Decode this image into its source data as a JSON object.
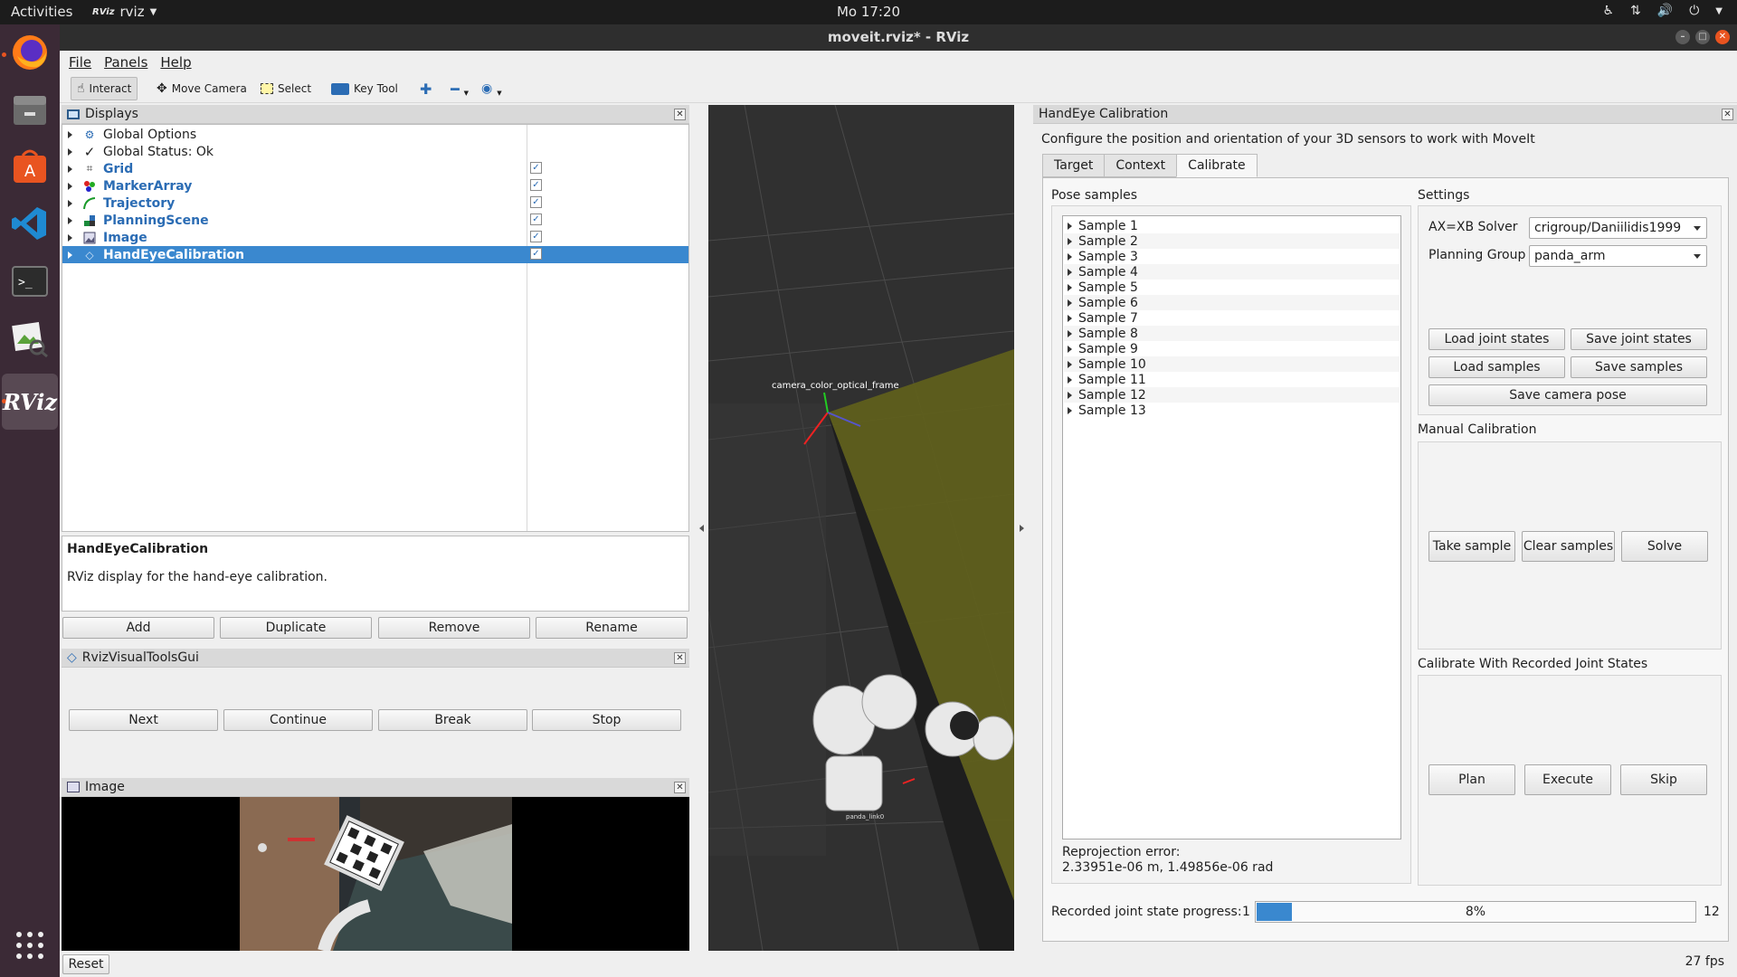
{
  "topbar": {
    "activities": "Activities",
    "app_icon": "RViz",
    "app_name": "rviz",
    "clock": "Mo 17:20"
  },
  "dock": {
    "apps": [
      "firefox-icon",
      "files-icon",
      "software-center-icon",
      "vscode-icon",
      "terminal-icon",
      "image-viewer-icon",
      "rviz-icon"
    ],
    "rviz_label": "RViz"
  },
  "window": {
    "title": "moveit.rviz* - RViz"
  },
  "menubar": {
    "items": [
      "File",
      "Panels",
      "Help"
    ]
  },
  "toolbar": {
    "interact": "Interact",
    "move_camera": "Move Camera",
    "select": "Select",
    "key_tool": "Key Tool"
  },
  "displays": {
    "title": "Displays",
    "items": [
      {
        "label": "Global Options"
      },
      {
        "label": "Global Status: Ok"
      },
      {
        "label": "Grid",
        "checked": true
      },
      {
        "label": "MarkerArray",
        "checked": true
      },
      {
        "label": "Trajectory",
        "checked": true
      },
      {
        "label": "PlanningScene",
        "checked": true
      },
      {
        "label": "Image",
        "checked": true
      },
      {
        "label": "HandEyeCalibration",
        "checked": true,
        "selected": true
      }
    ],
    "checkmark": "✓",
    "description_title": "HandEyeCalibration",
    "description_text": "RViz display for the hand-eye calibration.",
    "buttons": [
      "Add",
      "Duplicate",
      "Remove",
      "Rename"
    ]
  },
  "rviz_visual_tools": {
    "title": "RvizVisualToolsGui",
    "buttons": [
      "Next",
      "Continue",
      "Break",
      "Stop"
    ]
  },
  "image_panel": {
    "title": "Image"
  },
  "viewport": {
    "frame_label": "camera_color_optical_frame",
    "link_label": "panda_link0"
  },
  "handeye": {
    "title": "HandEye Calibration",
    "subtitle": "Configure the position and orientation of your 3D sensors to work with MoveIt",
    "tabs": [
      "Target",
      "Context",
      "Calibrate"
    ],
    "selected_tab": "Calibrate",
    "pose_samples_label": "Pose samples",
    "samples": [
      "Sample 1",
      "Sample 2",
      "Sample 3",
      "Sample 4",
      "Sample 5",
      "Sample 6",
      "Sample 7",
      "Sample 8",
      "Sample 9",
      "Sample 10",
      "Sample 11",
      "Sample 12",
      "Sample 13"
    ],
    "reprojection_label": "Reprojection error:",
    "reprojection_value": "2.33951e-06 m, 1.49856e-06 rad",
    "settings_label": "Settings",
    "solver_label": "AX=XB Solver",
    "solver_value": "crigroup/Daniilidis1999",
    "planning_group_label": "Planning Group",
    "planning_group_value": "panda_arm",
    "load_joint_states": "Load joint states",
    "save_joint_states": "Save joint states",
    "load_samples": "Load samples",
    "save_samples": "Save samples",
    "save_camera_pose": "Save camera pose",
    "manual_label": "Manual Calibration",
    "take_sample": "Take sample",
    "clear_samples": "Clear samples",
    "solve": "Solve",
    "recorded_label": "Calibrate With Recorded Joint States",
    "plan": "Plan",
    "execute": "Execute",
    "skip": "Skip",
    "progress_label": "Recorded joint state progress:",
    "progress_min": "1",
    "progress_max": "12",
    "progress_value": 0.08,
    "progress_text": "8%"
  },
  "statusbar": {
    "reset": "Reset",
    "fps": "27 fps"
  },
  "colors": {
    "selection": "#3a88cf",
    "progress": "#3a88cf",
    "dock": "#3b2a36",
    "topbar": "#1c1c1c",
    "ubuntu_orange": "#e95420"
  }
}
